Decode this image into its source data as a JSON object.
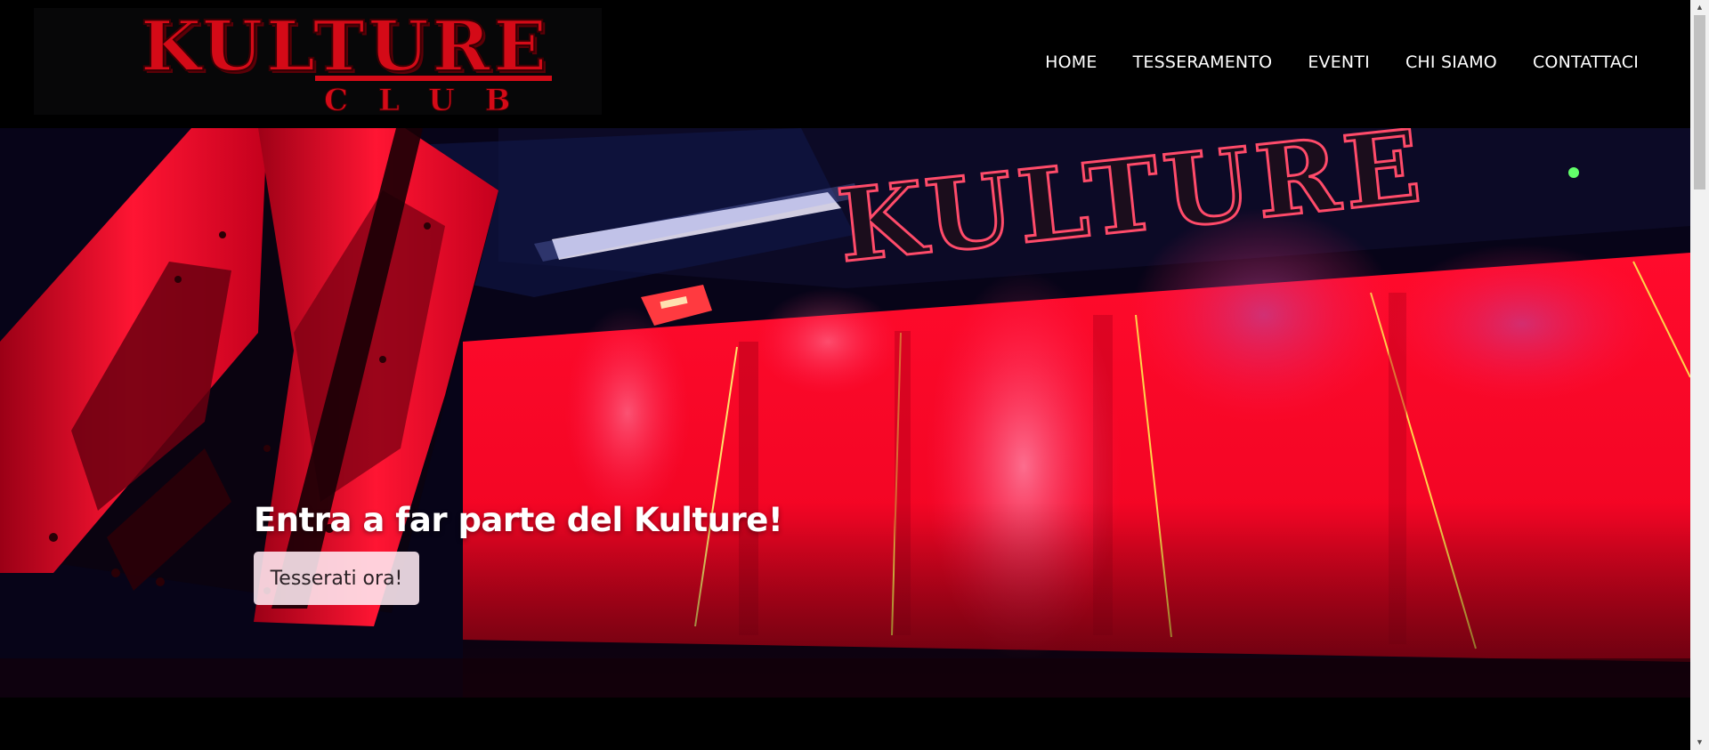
{
  "header": {
    "logo": {
      "top_text": "KULTURE",
      "bottom_text": "CLUB"
    },
    "nav": [
      {
        "label": "HOME"
      },
      {
        "label": "TESSERAMENTO"
      },
      {
        "label": "EVENTI"
      },
      {
        "label": "CHI SIAMO"
      },
      {
        "label": "CONTATTACI"
      }
    ]
  },
  "hero": {
    "title": "Entra a far parte del Kulture!",
    "cta_label": "Tesserati ora!",
    "sign_text": "KULTURE"
  },
  "colors": {
    "brand_red": "#d40a17",
    "background": "#000000",
    "hero_glow": "#ff0a2a",
    "hero_dark": "#070418"
  },
  "icons": {
    "scroll_up": "triangle-up",
    "scroll_down": "triangle-down"
  }
}
